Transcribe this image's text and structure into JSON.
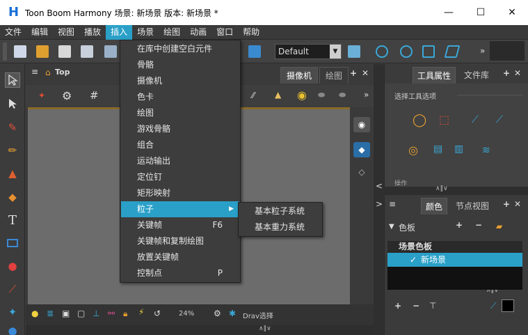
{
  "window": {
    "title": "Toon Boom Harmony 场景: 新场景 版本: 新场景 *",
    "app_icon": "H",
    "minimize_glyph": "—",
    "maximize_glyph": "☐",
    "close_glyph": "✕"
  },
  "menubar": {
    "items": [
      "文件",
      "编辑",
      "视图",
      "播放",
      "插入",
      "场景",
      "绘图",
      "动画",
      "窗口",
      "帮助"
    ],
    "active": "插入"
  },
  "toolbar": {
    "view_select_value": "Default"
  },
  "insert_menu": {
    "items": [
      {
        "label": "在库中创建空白元件",
        "shortcut": ""
      },
      {
        "label": "骨骼",
        "shortcut": ""
      },
      {
        "label": "摄像机",
        "shortcut": ""
      },
      {
        "label": "色卡",
        "shortcut": ""
      },
      {
        "label": "绘图",
        "shortcut": ""
      },
      {
        "label": "游戏骨骼",
        "shortcut": ""
      },
      {
        "label": "组合",
        "shortcut": ""
      },
      {
        "label": "运动输出",
        "shortcut": ""
      },
      {
        "label": "定位钉",
        "shortcut": ""
      },
      {
        "label": "矩形映射",
        "shortcut": ""
      },
      {
        "label": "粒子",
        "shortcut": "",
        "submenu": true
      },
      {
        "label": "关键帧",
        "shortcut": "F6"
      },
      {
        "label": "关键帧和复制绘图",
        "shortcut": ""
      },
      {
        "label": "放置关键帧",
        "shortcut": ""
      },
      {
        "label": "控制点",
        "shortcut": "P"
      }
    ],
    "highlighted": "粒子"
  },
  "particle_submenu": {
    "items": [
      "基本粒子系统",
      "基本重力系统"
    ]
  },
  "view": {
    "breadcrumb": "Top",
    "tabs": [
      "摄像机",
      "绘图"
    ],
    "active_tab": "摄像机",
    "zoom": "24%",
    "draw_select_label": "Drav选择"
  },
  "tool_properties": {
    "tabs": [
      "工具属性",
      "文件库"
    ],
    "active_tab": "工具属性",
    "section_label": "选择工具选项",
    "cutoff_label": "操作"
  },
  "colour_panel": {
    "tabs": [
      "颜色",
      "节点视图"
    ],
    "active_tab": "颜色",
    "palette_label": "色板",
    "list_header": "场景色板",
    "selected_palette": "新场景",
    "check_glyph": "✓"
  },
  "colors": {
    "accent": "#2aa0c8",
    "background": "#3b3b3b",
    "canvas": "#6c6c6c"
  }
}
